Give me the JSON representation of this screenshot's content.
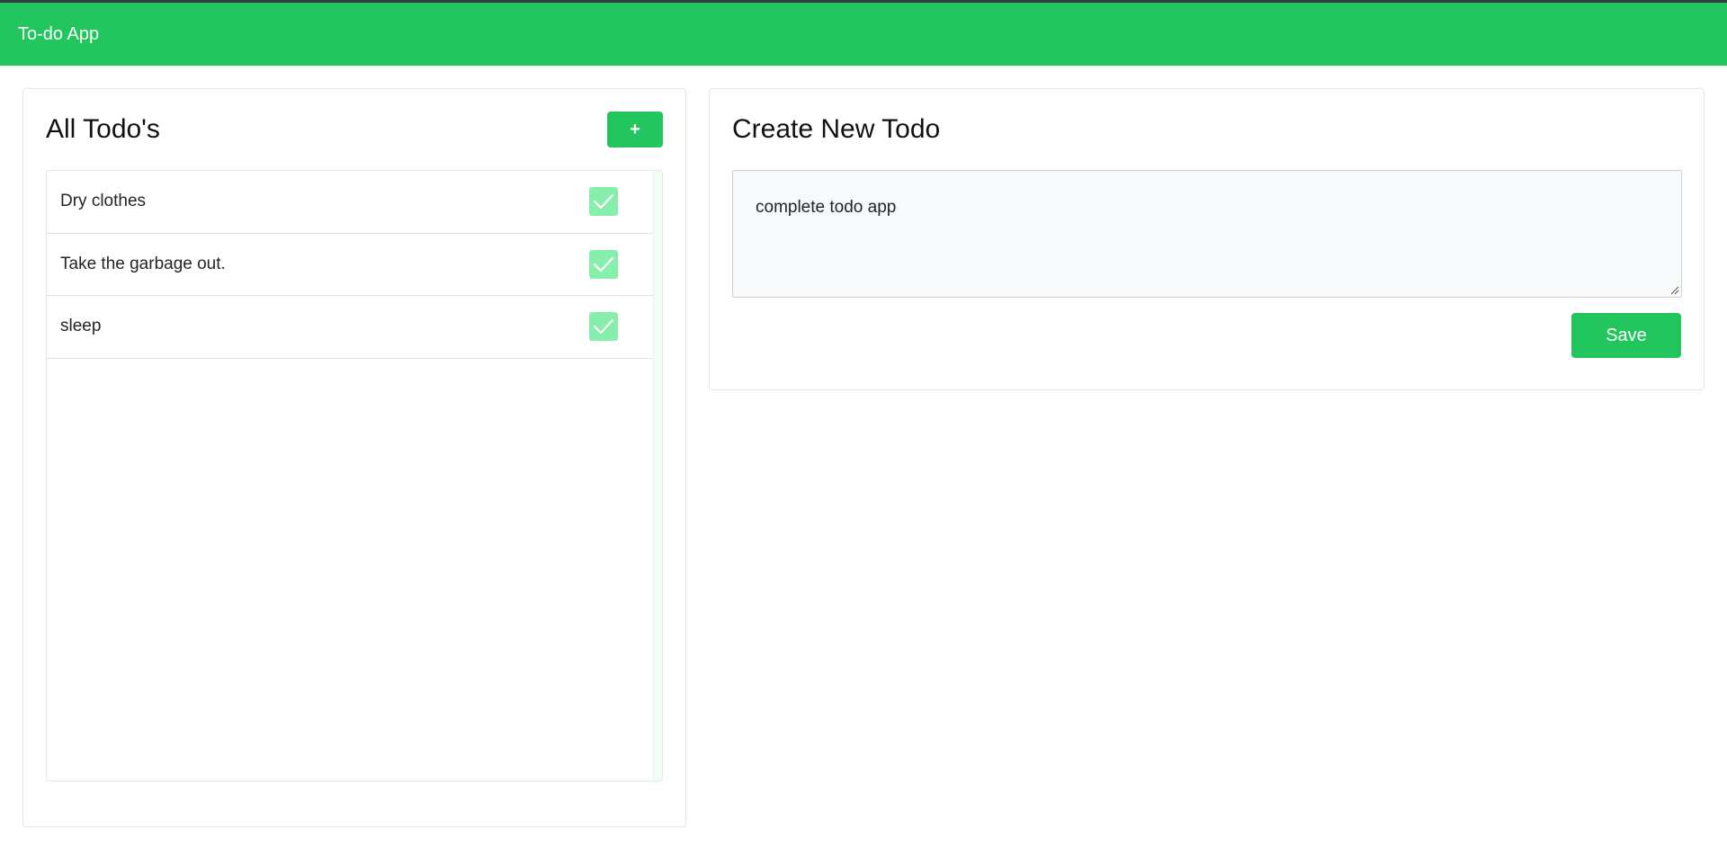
{
  "navbar": {
    "brand": "To-do App",
    "color": "#22c55e"
  },
  "todo_list": {
    "title": "All Todo's",
    "add_button_label": "+",
    "items": [
      {
        "text": "Dry clothes",
        "completed": true,
        "icon": "check-icon"
      },
      {
        "text": "Take the garbage out.",
        "completed": true,
        "icon": "check-icon"
      },
      {
        "text": "sleep",
        "completed": true,
        "icon": "check-icon"
      }
    ]
  },
  "create_todo": {
    "title": "Create New Todo",
    "input_value": "complete todo app",
    "save_label": "Save"
  },
  "colors": {
    "accent": "#22c55e",
    "check_fill": "#86efac"
  }
}
